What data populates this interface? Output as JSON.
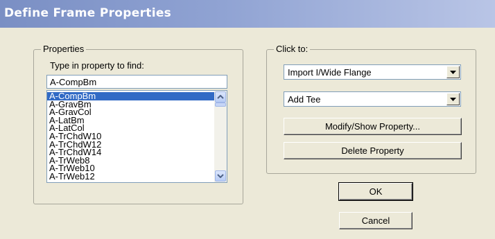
{
  "window": {
    "title": "Define Frame Properties"
  },
  "properties": {
    "group_label": "Properties",
    "find_label": "Type in property to find:",
    "find_value": "A-CompBm",
    "items": [
      "A-CompBm",
      "A-GravBm",
      "A-GravCol",
      "A-LatBm",
      "A-LatCol",
      "A-TrChdW10",
      "A-TrChdW12",
      "A-TrChdW14",
      "A-TrWeb8",
      "A-TrWeb10",
      "A-TrWeb12"
    ],
    "selected": "A-CompBm"
  },
  "click_to": {
    "group_label": "Click to:",
    "import_combo": "Import I/Wide Flange",
    "add_combo": "Add Tee",
    "modify_button": "Modify/Show Property...",
    "delete_button": "Delete Property"
  },
  "footer": {
    "ok_button": "OK",
    "cancel_button": "Cancel"
  },
  "colors": {
    "titlebar": "#7a8fc4",
    "selection": "#316ac5",
    "dialog_bg": "#ece9d8"
  },
  "icons": [
    "scroll-up-arrow-icon",
    "scroll-down-arrow-icon",
    "dropdown-arrow-icon"
  ]
}
